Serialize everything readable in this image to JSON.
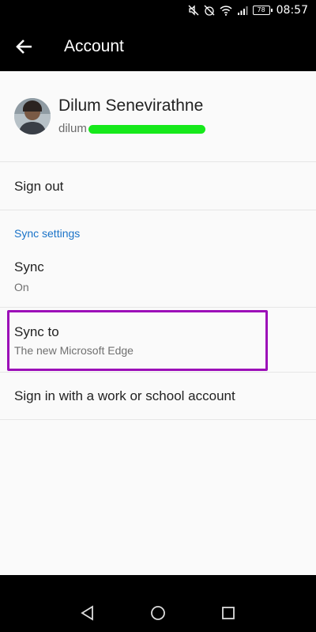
{
  "status_bar": {
    "battery": "78",
    "time": "08:57",
    "icons": [
      "mute-icon",
      "alarm-off-icon",
      "wifi-icon",
      "signal-icon",
      "battery-icon"
    ]
  },
  "app_bar": {
    "title": "Account",
    "back_icon": "back-arrow-icon"
  },
  "profile": {
    "name": "Dilum Senevirathne",
    "email_visible": "dilum                         .com"
  },
  "rows": {
    "sign_out": "Sign out",
    "section_header": "Sync settings",
    "sync": {
      "title": "Sync",
      "subtitle": "On"
    },
    "sync_to": {
      "title": "Sync to",
      "subtitle": "The new Microsoft Edge"
    },
    "work_account": "Sign in with a work or school account"
  },
  "colors": {
    "accent_blue": "#1a73c8",
    "highlight_purple": "#9c0fb8",
    "redaction_green": "#16e91b"
  },
  "nav_bar": {
    "icons": [
      "nav-back-icon",
      "nav-home-icon",
      "nav-recents-icon"
    ]
  }
}
